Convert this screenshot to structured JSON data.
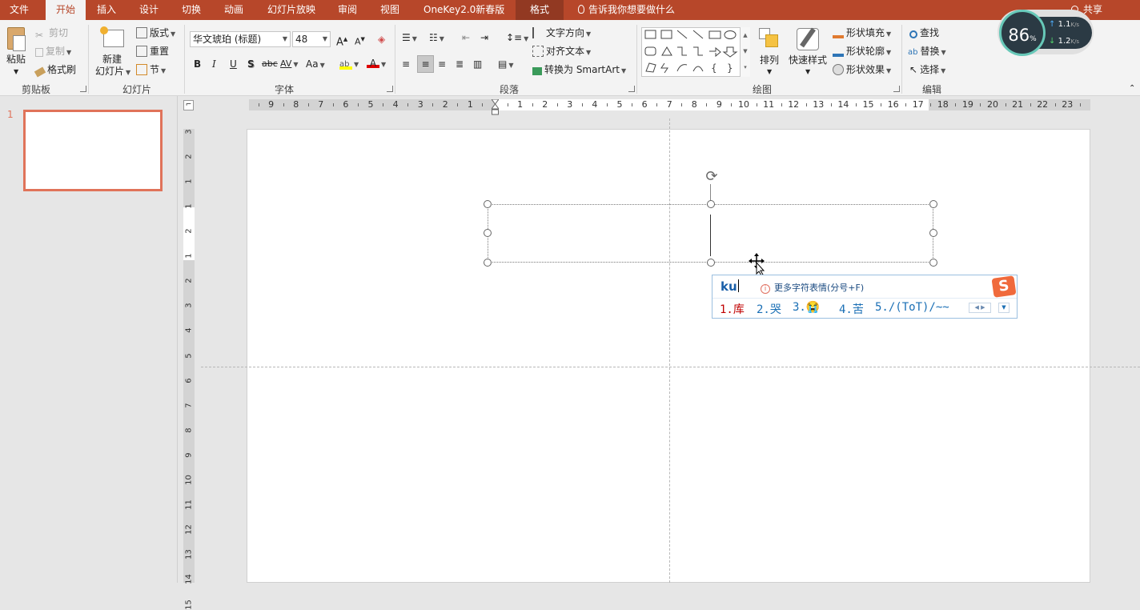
{
  "tabs": [
    "文件",
    "开始",
    "插入",
    "设计",
    "切换",
    "动画",
    "幻灯片放映",
    "审阅",
    "视图",
    "OneKey2.0新春版",
    "格式"
  ],
  "active_tab": "开始",
  "tell_me": "告诉我你想要做什么",
  "share": "共享",
  "clipboard": {
    "paste": "粘贴",
    "cut": "剪切",
    "copy": "复制",
    "format_painter": "格式刷",
    "group": "剪贴板"
  },
  "slides": {
    "new_slide_line1": "新建",
    "new_slide_line2": "幻灯片",
    "layout": "版式",
    "reset": "重置",
    "section": "节",
    "group": "幻灯片"
  },
  "font": {
    "name": "华文琥珀 (标题)",
    "size": "48",
    "bold": "B",
    "italic": "I",
    "underline": "U",
    "shadow": "S",
    "strike": "abc",
    "spacing": "AV",
    "case": "Aa",
    "group": "字体"
  },
  "paragraph": {
    "text_direction": "文字方向",
    "align_text": "对齐文本",
    "smartart": "转换为 SmartArt",
    "group": "段落"
  },
  "drawing": {
    "arrange": "排列",
    "quick_styles": "快速样式",
    "shape_fill": "形状填充",
    "shape_outline": "形状轮廓",
    "shape_effects": "形状效果",
    "group": "绘图"
  },
  "editing": {
    "find": "查找",
    "replace": "替换",
    "select": "选择",
    "group": "编辑"
  },
  "thumb_number": "1",
  "ruler_h": [
    "9",
    "8",
    "7",
    "6",
    "5",
    "4",
    "3",
    "2",
    "1",
    "1",
    "2",
    "3",
    "4",
    "5",
    "6",
    "7",
    "8",
    "9",
    "10",
    "11",
    "12",
    "13",
    "14",
    "15",
    "16",
    "17",
    "18",
    "19",
    "20",
    "21",
    "22",
    "23"
  ],
  "ruler_v": [
    "3",
    "2",
    "1",
    "1",
    "2",
    "1",
    "2",
    "3",
    "4",
    "5",
    "6",
    "7",
    "8",
    "9",
    "10",
    "11",
    "12",
    "13",
    "14",
    "15"
  ],
  "ime": {
    "input": "ku",
    "hint": "更多字符表情(分号+F)",
    "candidates": [
      "1.库",
      "2.哭",
      "3.😭",
      "4.苦",
      "5./(ToT)/~~"
    ]
  },
  "speed": {
    "percent": "86",
    "unit": "%",
    "up": "1.1",
    "down": "1.2",
    "rate_unit": "K/s"
  },
  "colors": {
    "brand": "#b7472a",
    "ribbon": "#f3f3f3",
    "thumb_border": "#e0735a",
    "ime_first": "#c00000",
    "ime_other": "#1a6fb5"
  }
}
